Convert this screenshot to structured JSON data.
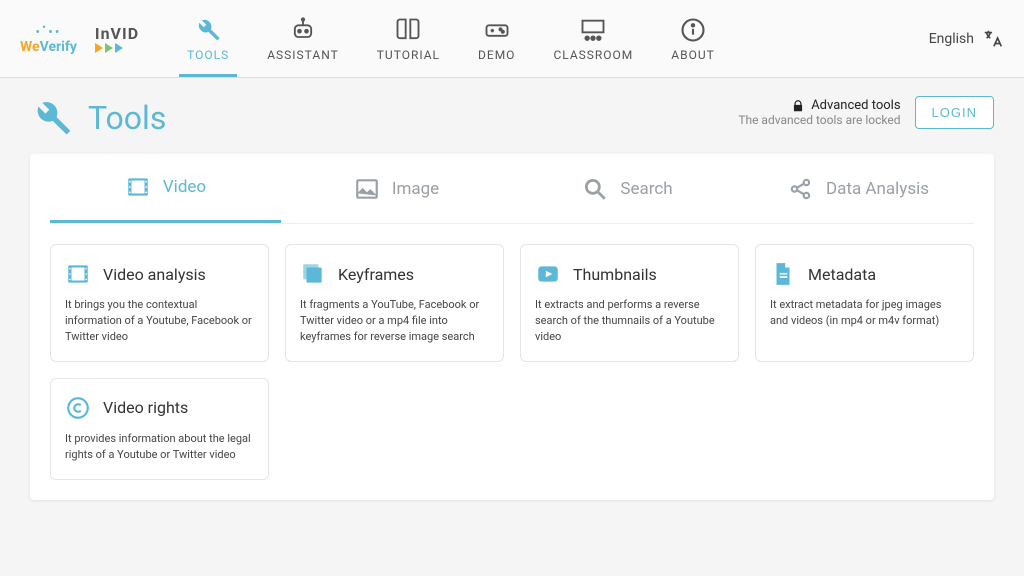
{
  "brand": {
    "weverify": "WeVerify",
    "invid": "InVID"
  },
  "nav": {
    "items": [
      {
        "label": "TOOLS"
      },
      {
        "label": "ASSISTANT"
      },
      {
        "label": "TUTORIAL"
      },
      {
        "label": "DEMO"
      },
      {
        "label": "CLASSROOM"
      },
      {
        "label": "ABOUT"
      }
    ]
  },
  "lang": {
    "label": "English"
  },
  "page": {
    "title": "Tools",
    "locked_title": "Advanced tools",
    "locked_sub": "The advanced tools are locked",
    "login": "LOGIN"
  },
  "tabs": [
    {
      "label": "Video"
    },
    {
      "label": "Image"
    },
    {
      "label": "Search"
    },
    {
      "label": "Data Analysis"
    }
  ],
  "tools": [
    {
      "title": "Video analysis",
      "desc": "It brings you the contextual information of a Youtube, Facebook or Twitter video"
    },
    {
      "title": "Keyframes",
      "desc": "It fragments a YouTube, Facebook or Twitter video or a mp4 file into keyframes for reverse image search"
    },
    {
      "title": "Thumbnails",
      "desc": "It extracts and performs a reverse search of the thumnails of a Youtube video"
    },
    {
      "title": "Metadata",
      "desc": "It extract metadata for jpeg images and videos (in mp4 or m4v format)"
    },
    {
      "title": "Video rights",
      "desc": "It provides information about the legal rights of a Youtube or Twitter video"
    }
  ]
}
